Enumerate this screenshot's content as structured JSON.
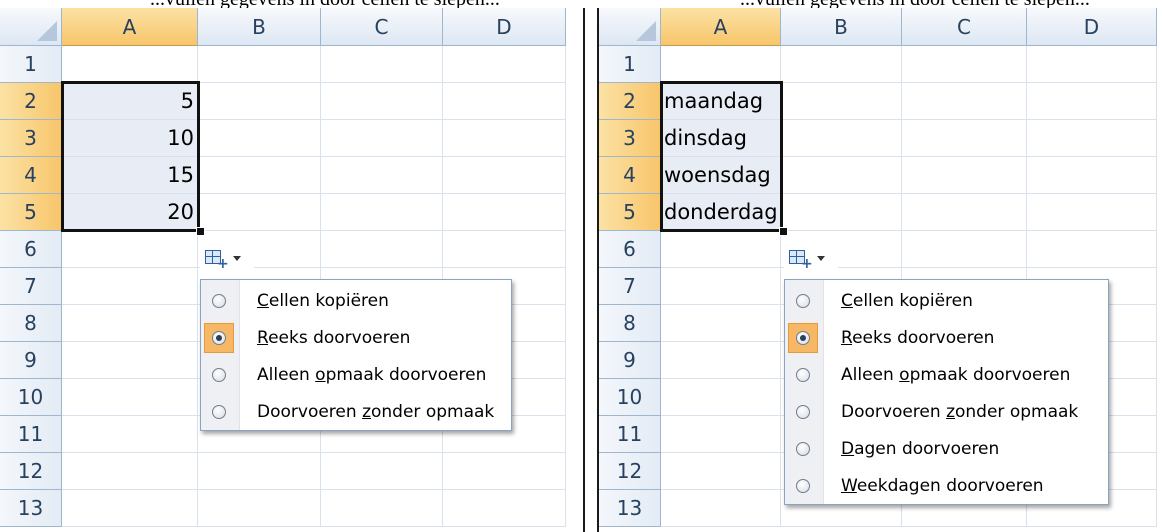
{
  "top_caption": {
    "left": "...vullen gegevens in door cellen te slepen...",
    "right": "...vullen gegevens in door cellen te slepen..."
  },
  "colors": {
    "header_selected": "#f8c56b",
    "selection_fill": "#e8ecf5",
    "radio_highlight": "#f7b866"
  },
  "columns": [
    "A",
    "B",
    "C",
    "D"
  ],
  "rows": [
    "1",
    "2",
    "3",
    "4",
    "5",
    "6",
    "7",
    "8",
    "9",
    "10",
    "11",
    "12",
    "13"
  ],
  "left": {
    "cells_A": [
      "",
      "5",
      "10",
      "15",
      "20"
    ],
    "menu": [
      {
        "pre": "",
        "u": "C",
        "post": "ellen kopiëren",
        "checked": false
      },
      {
        "pre": "",
        "u": "R",
        "post": "eeks doorvoeren",
        "checked": true
      },
      {
        "pre": "Alleen ",
        "u": "o",
        "post": "pmaak doorvoeren",
        "checked": false
      },
      {
        "pre": "Doorvoeren ",
        "u": "z",
        "post": "onder opmaak",
        "checked": false
      }
    ]
  },
  "right": {
    "cells_A": [
      "",
      "maandag",
      "dinsdag",
      "woensdag",
      "donderdag"
    ],
    "menu": [
      {
        "pre": "",
        "u": "C",
        "post": "ellen kopiëren",
        "checked": false
      },
      {
        "pre": "",
        "u": "R",
        "post": "eeks doorvoeren",
        "checked": true
      },
      {
        "pre": "Alleen ",
        "u": "o",
        "post": "pmaak doorvoeren",
        "checked": false
      },
      {
        "pre": "Doorvoeren ",
        "u": "z",
        "post": "onder opmaak",
        "checked": false
      },
      {
        "pre": "",
        "u": "D",
        "post": "agen doorvoeren",
        "checked": false
      },
      {
        "pre": "",
        "u": "W",
        "post": "eekdagen doorvoeren",
        "checked": false
      }
    ]
  },
  "autofill_icon": "autofill-options-icon"
}
